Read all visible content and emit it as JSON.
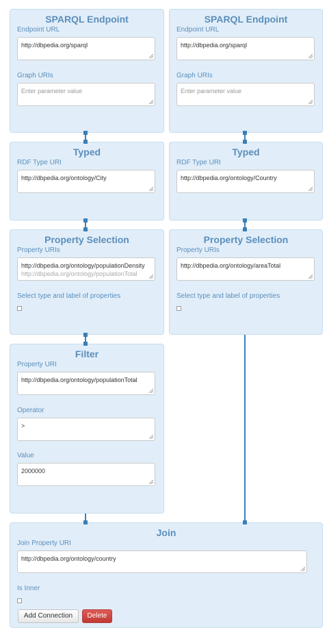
{
  "nodes": {
    "sparql_left": {
      "title": "SPARQL Endpoint",
      "endpoint_label": "Endpoint URL",
      "endpoint_value": "http://dbpedia.org/sparql",
      "graph_label": "Graph URIs",
      "graph_placeholder": "Enter parameter value"
    },
    "sparql_right": {
      "title": "SPARQL Endpoint",
      "endpoint_label": "Endpoint URL",
      "endpoint_value": "http://dbpedia.org/sparql",
      "graph_label": "Graph URIs",
      "graph_placeholder": "Enter parameter value"
    },
    "typed_left": {
      "title": "Typed",
      "type_label": "RDF Type URI",
      "type_value": "http://dbpedia.org/ontology/City"
    },
    "typed_right": {
      "title": "Typed",
      "type_label": "RDF Type URI",
      "type_value": "http://dbpedia.org/ontology/Country"
    },
    "prop_left": {
      "title": "Property Selection",
      "uris_label": "Property URIs",
      "uris_value": "http://dbpedia.org/ontology/populationDensity",
      "uris_value_2": "http://dbpedia.org/ontology/populationTotal",
      "select_label": "Select type and label of properties"
    },
    "prop_right": {
      "title": "Property Selection",
      "uris_label": "Property URIs",
      "uris_value": "http://dbpedia.org/ontology/areaTotal",
      "select_label": "Select type and label of properties"
    },
    "filter": {
      "title": "Filter",
      "property_label": "Property URI",
      "property_value": "http://dbpedia.org/ontology/populationTotal",
      "operator_label": "Operator",
      "operator_value": ">",
      "value_label": "Value",
      "value_value": "2000000"
    },
    "join": {
      "title": "Join",
      "property_label": "Join Property URI",
      "property_value": "http://dbpedia.org/ontology/country",
      "inner_label": "Is Inner",
      "add_label": "Add Connection",
      "delete_label": "Delete"
    }
  },
  "colors": {
    "panel_bg": "#e1eef9",
    "panel_border": "#c6dcee",
    "title": "#5b8ebb",
    "connector": "#3c7fb6",
    "delete_button": "#c9403b"
  }
}
